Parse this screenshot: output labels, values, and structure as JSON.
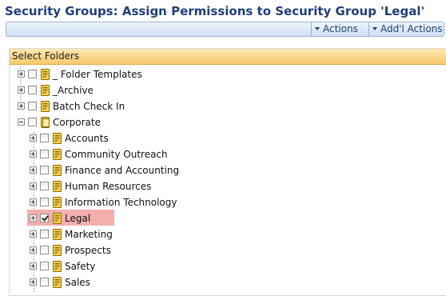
{
  "page": {
    "title": "Security Groups: Assign Permissions to Security Group 'Legal'"
  },
  "toolbar": {
    "actions_label": "Actions",
    "addl_actions_label": "Add'l Actions"
  },
  "panel": {
    "header": "Select Folders"
  },
  "tree": {
    "root_items": [
      {
        "label": "_ Folder Templates",
        "checked": false,
        "expanded": false
      },
      {
        "label": "_Archive",
        "checked": false,
        "expanded": false
      },
      {
        "label": "Batch Check In",
        "checked": false,
        "expanded": false
      },
      {
        "label": "Corporate",
        "checked": false,
        "expanded": true
      }
    ],
    "corporate_children": [
      {
        "label": "Accounts",
        "checked": false
      },
      {
        "label": "Community Outreach",
        "checked": false
      },
      {
        "label": "Finance and Accounting",
        "checked": false
      },
      {
        "label": "Human Resources",
        "checked": false
      },
      {
        "label": "Information Technology",
        "checked": false
      },
      {
        "label": "Legal",
        "checked": true,
        "selected": true
      },
      {
        "label": "Marketing",
        "checked": false
      },
      {
        "label": "Prospects",
        "checked": false
      },
      {
        "label": "Safety",
        "checked": false
      },
      {
        "label": "Sales",
        "checked": false
      }
    ]
  },
  "colors": {
    "title": "#1f3f7a",
    "panel_header": "#f7c96a",
    "selection_highlight": "#f2a0a0",
    "folder_fill": "#f5d04a"
  },
  "icons": {
    "folder": "folder-icon",
    "open_folder": "folder-open-icon",
    "expand": "plus-expander-icon",
    "collapse": "minus-expander-icon",
    "dropdown": "chevron-down-icon"
  }
}
